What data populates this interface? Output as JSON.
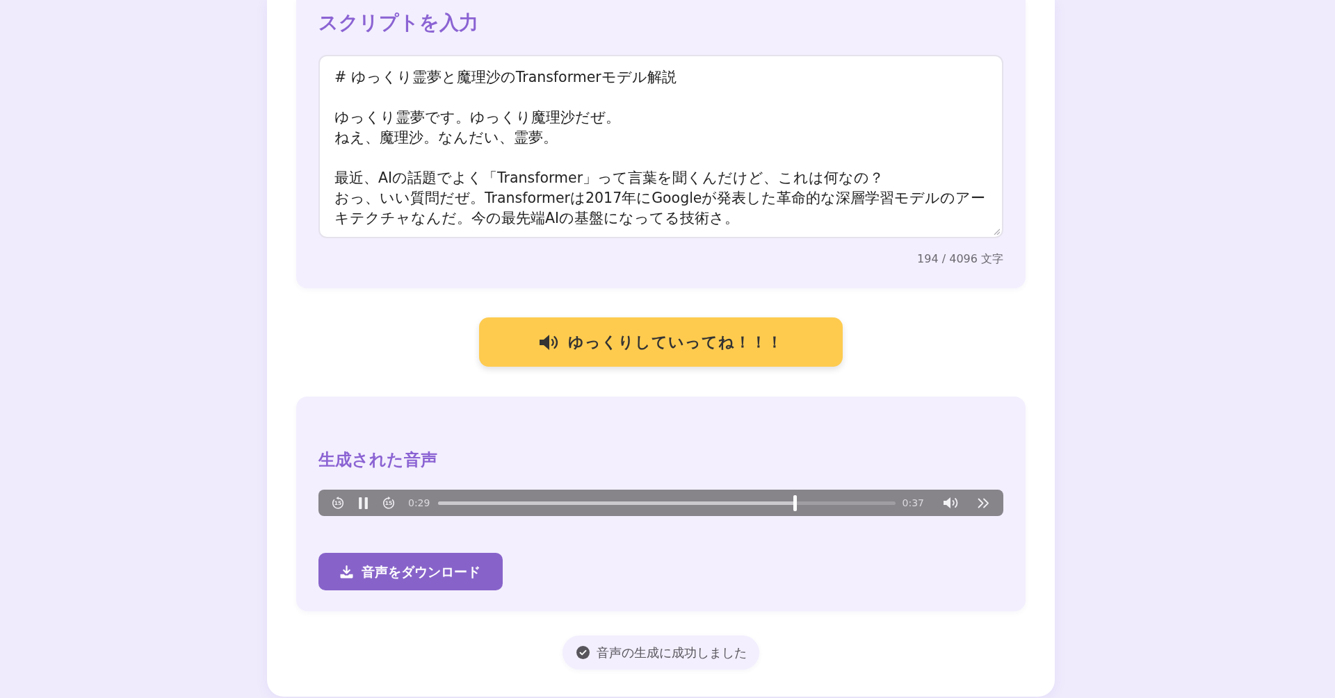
{
  "script_section": {
    "title": "スクリプトを入力",
    "script_input": {
      "paragraphs": [
        {
          "lines": [
            "# ゆっくり霊夢と魔理沙のTransformerモデル解説"
          ]
        },
        {
          "lines": [
            "ゆっくり霊夢です。ゆっくり魔理沙だぜ。",
            "ねえ、魔理沙。なんだい、霊夢。"
          ]
        },
        {
          "lines": [
            "最近、AIの話題でよく「Transformer」って言葉を聞くんだけど、これは何なの？",
            "おっ、いい質問だぜ。Transformerは2017年にGoogleが発表した革命的な深層学習モデルのアーキテクチャなんだ。今の最先端AIの基盤になってる技術さ。"
          ]
        }
      ]
    },
    "character_count": "194 / 4096 文字"
  },
  "generate_button": {
    "label": "ゆっくりしていってね！！！"
  },
  "output_section": {
    "title": "生成された音声",
    "audio_player": {
      "skip_back_label": "15",
      "playing": true,
      "skip_forward_label": "15",
      "elapsed": "0:29",
      "level": 0.78,
      "duration": "0:37"
    },
    "download_button": {
      "label": "音声をダウンロード"
    }
  },
  "status_message": {
    "text": "音声の生成に成功しました"
  }
}
